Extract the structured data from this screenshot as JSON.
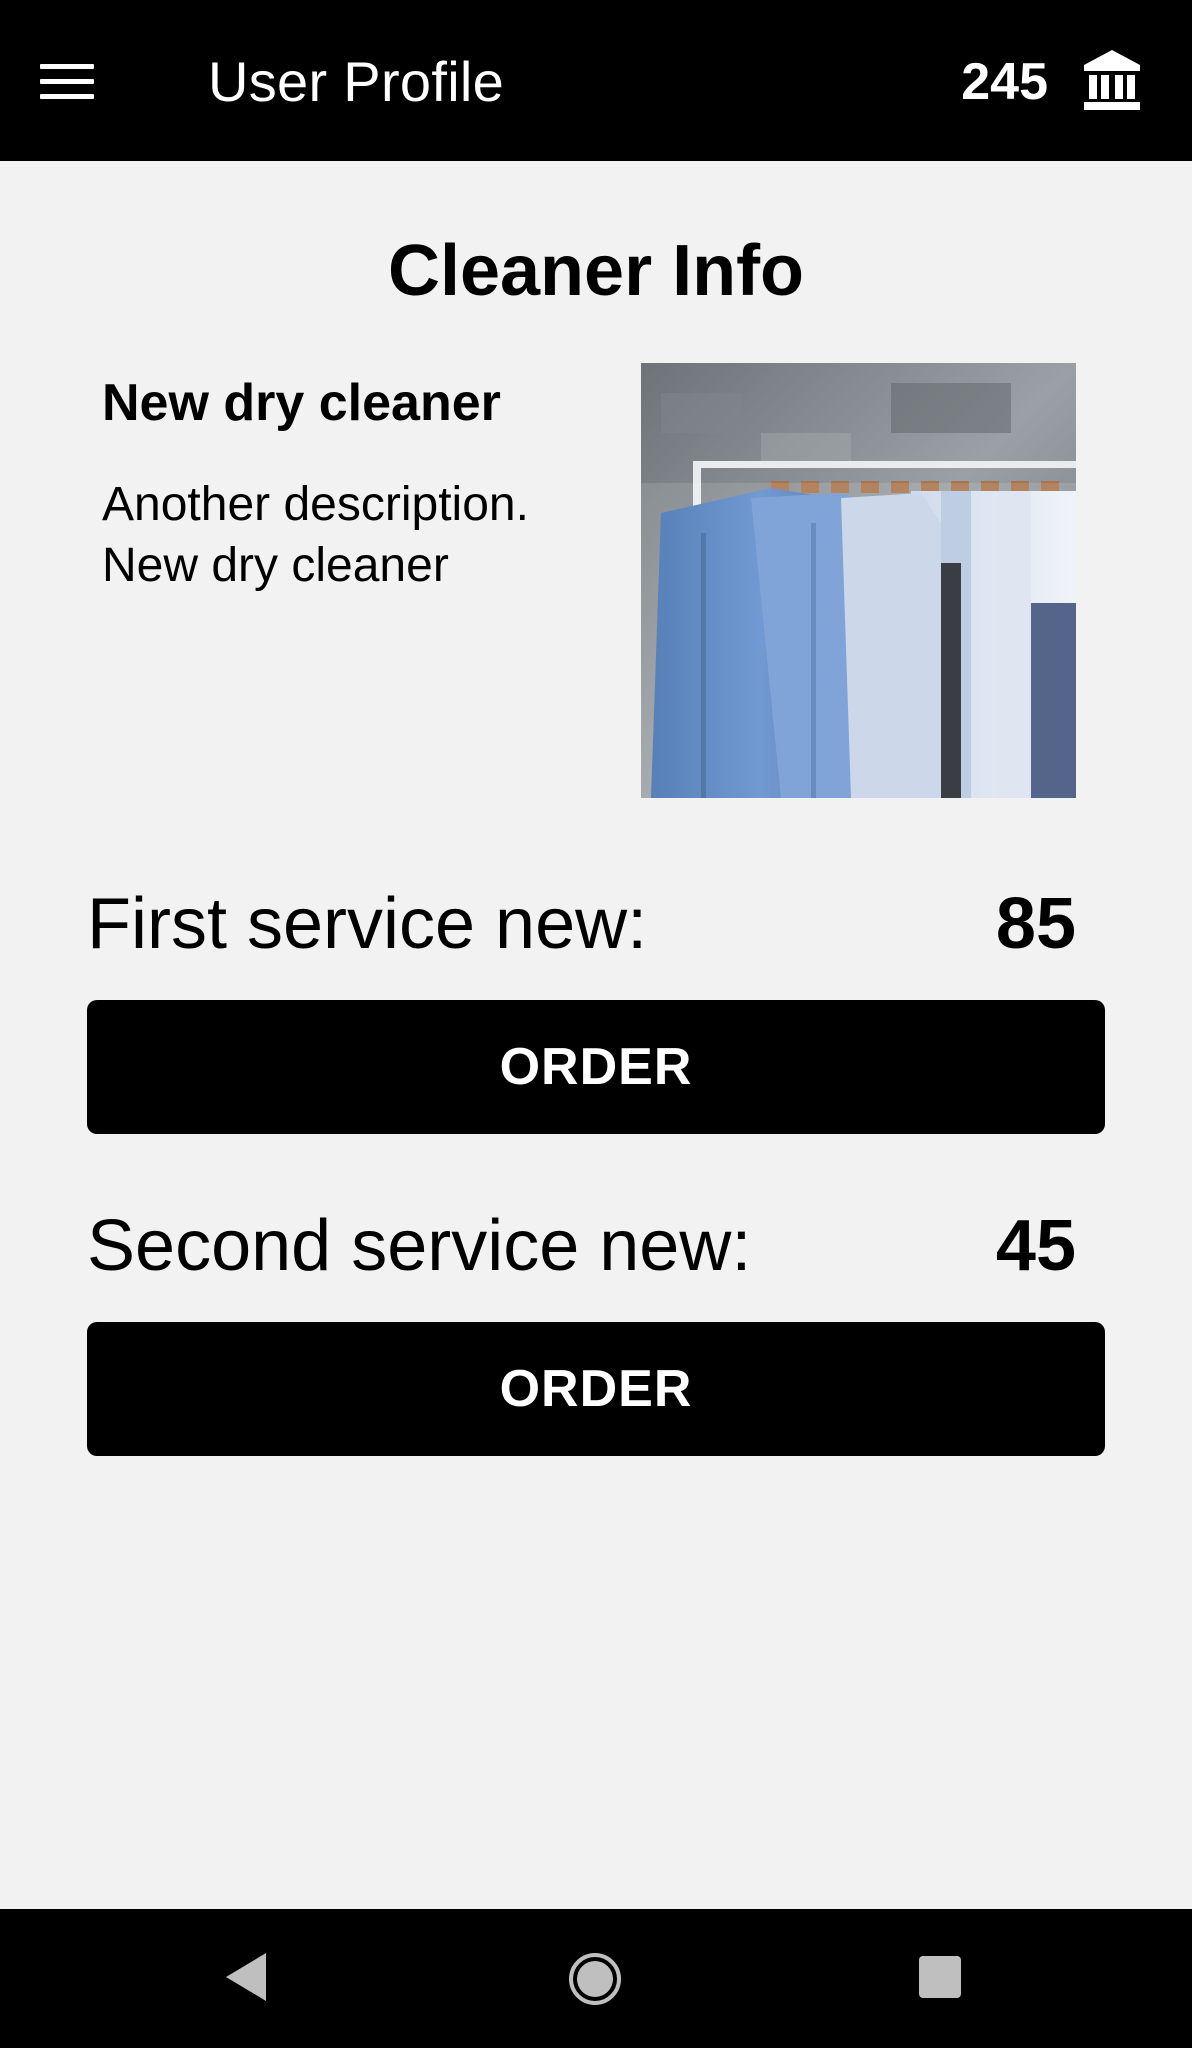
{
  "app_bar": {
    "title": "User Profile",
    "balance": "245",
    "menu_icon": "hamburger-menu-icon",
    "bank_icon": "bank-icon"
  },
  "section_title": "Cleaner Info",
  "cleaner": {
    "name": "New dry cleaner",
    "description": "Another description. New dry cleaner",
    "photo": "clothes-rack-photo"
  },
  "services": [
    {
      "label": "First service new:",
      "price": "85",
      "button_label": "ORDER"
    },
    {
      "label": "Second service new:",
      "price": "45",
      "button_label": "ORDER"
    }
  ],
  "nav_bar": {
    "back_icon": "back-icon",
    "home_icon": "home-icon",
    "recents_icon": "recents-icon"
  },
  "colors": {
    "app_bar_bg": "#000000",
    "background": "#f2f2f2",
    "button_bg": "#000000",
    "button_text": "#ffffff"
  }
}
